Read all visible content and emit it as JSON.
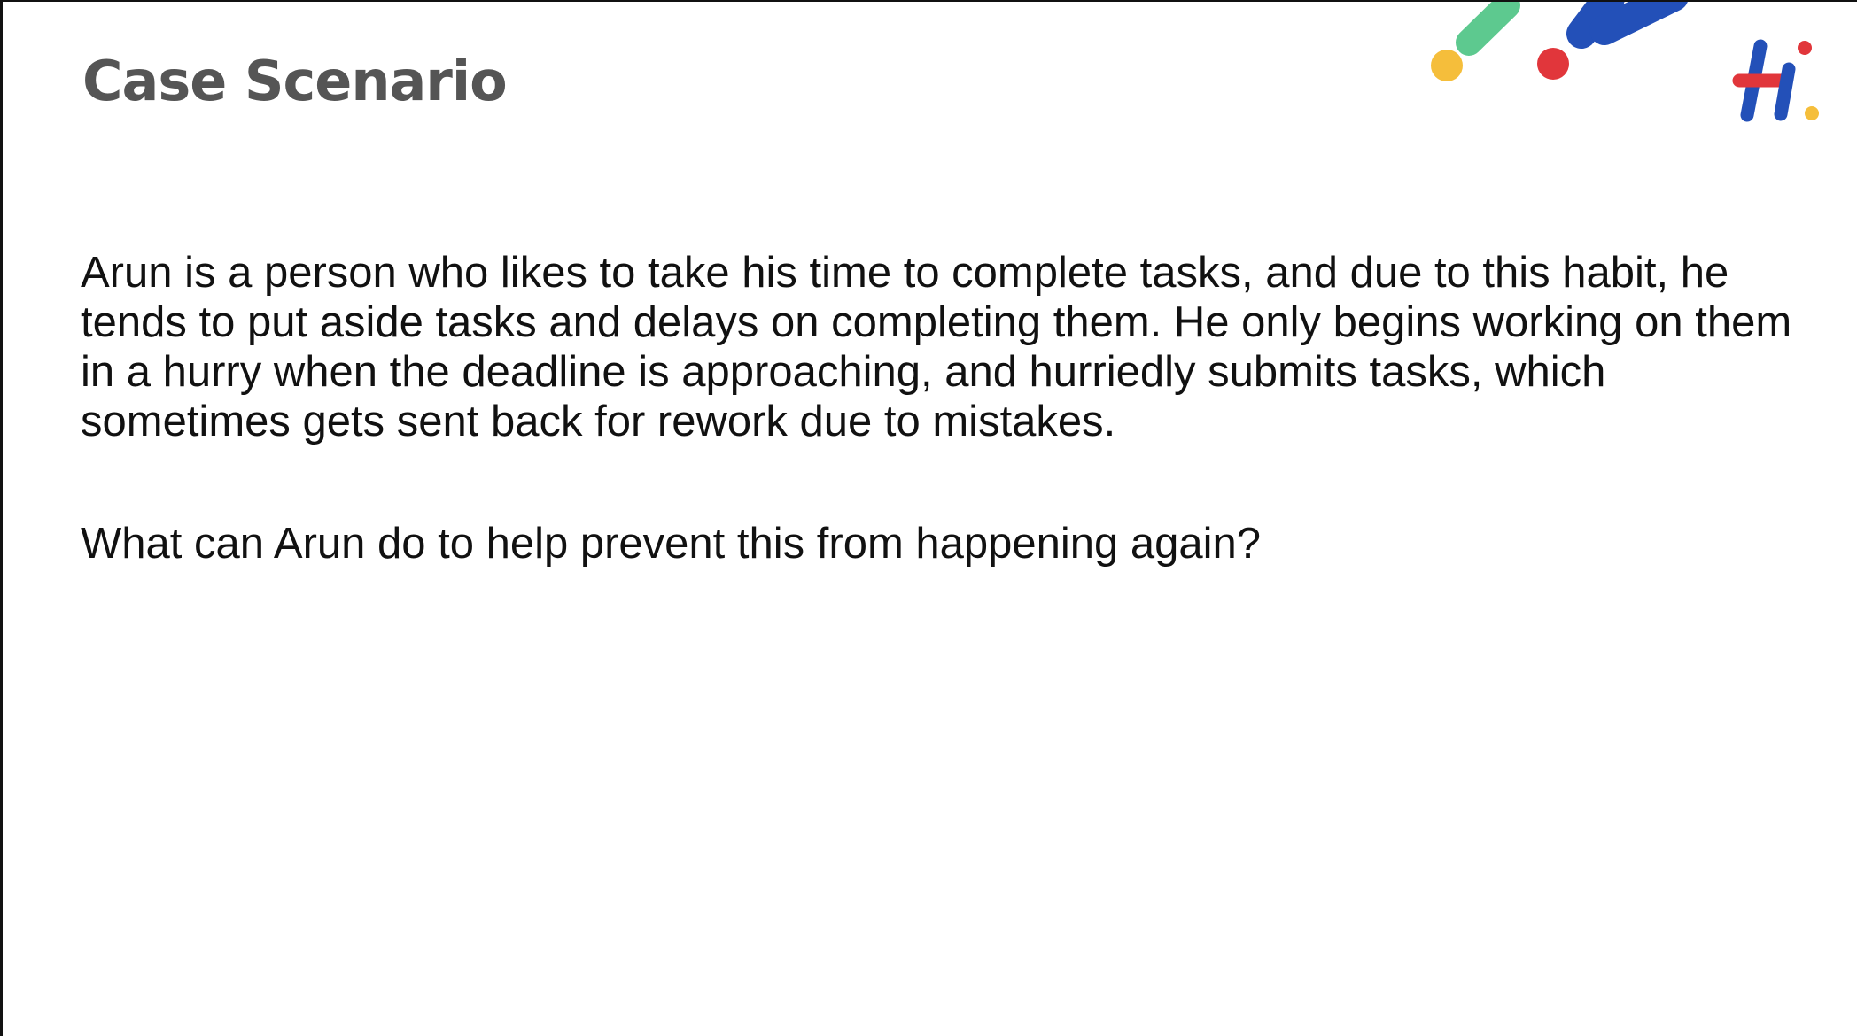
{
  "slide": {
    "title": "Case Scenario",
    "paragraph": "Arun is a person who likes to take his time to complete tasks, and due to this habit, he tends to put aside tasks and delays on completing them. He only begins working on them in a hurry when the deadline is approaching, and hurriedly submits tasks, which sometimes gets sent back for rework due to mistakes.",
    "question": "What can Arun do to help prevent this from happening again?"
  },
  "logo": {
    "text": "hi",
    "colors": {
      "blue": "#2350B8",
      "red": "#E1363B",
      "yellow": "#F5BE3B",
      "green": "#5DC98F"
    }
  }
}
